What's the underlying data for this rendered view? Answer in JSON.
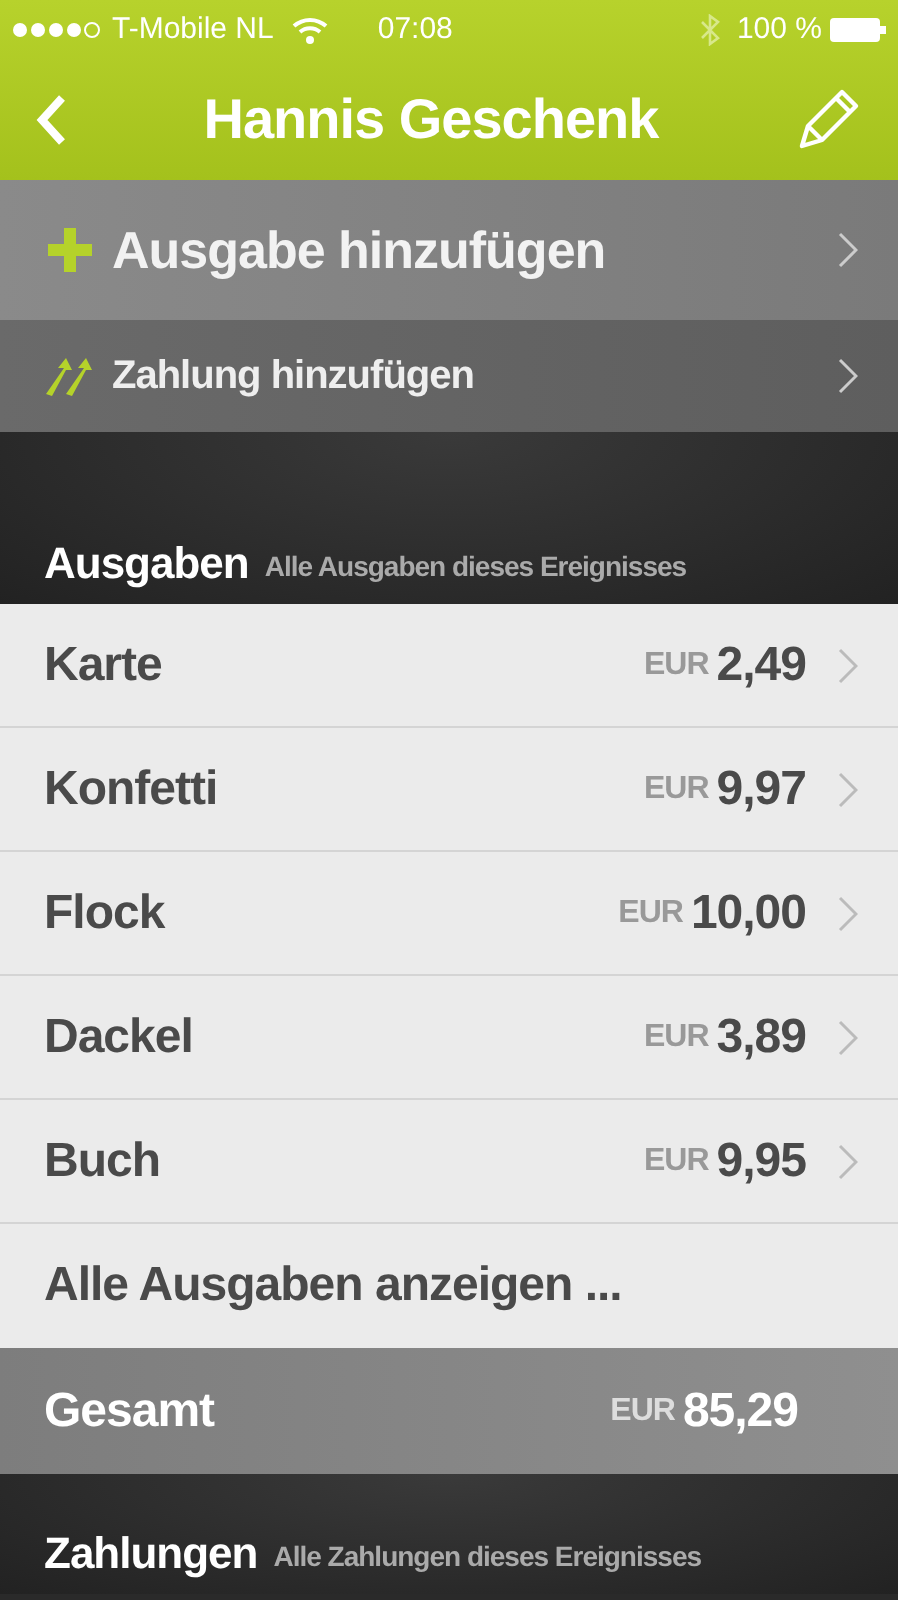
{
  "status_bar": {
    "carrier": "T-Mobile NL",
    "time": "07:08",
    "battery": "100 %"
  },
  "nav": {
    "title": "Hannis Geschenk"
  },
  "actions": [
    {
      "kind": "expense",
      "label": "Ausgabe hinzufügen"
    },
    {
      "kind": "payment",
      "label": "Zahlung hinzufügen"
    }
  ],
  "expenses": {
    "title": "Ausgaben",
    "subtitle": "Alle Ausgaben dieses Ereignisses",
    "items": [
      {
        "name": "Karte",
        "currency": "EUR",
        "amount": "2,49"
      },
      {
        "name": "Konfetti",
        "currency": "EUR",
        "amount": "9,97"
      },
      {
        "name": "Flock",
        "currency": "EUR",
        "amount": "10,00"
      },
      {
        "name": "Dackel",
        "currency": "EUR",
        "amount": "3,89"
      },
      {
        "name": "Buch",
        "currency": "EUR",
        "amount": "9,95"
      }
    ],
    "show_all": "Alle Ausgaben anzeigen ...",
    "total": {
      "label": "Gesamt",
      "currency": "EUR",
      "amount": "85,29"
    }
  },
  "payments": {
    "title": "Zahlungen",
    "subtitle": "Alle Zahlungen dieses Ereignisses"
  }
}
